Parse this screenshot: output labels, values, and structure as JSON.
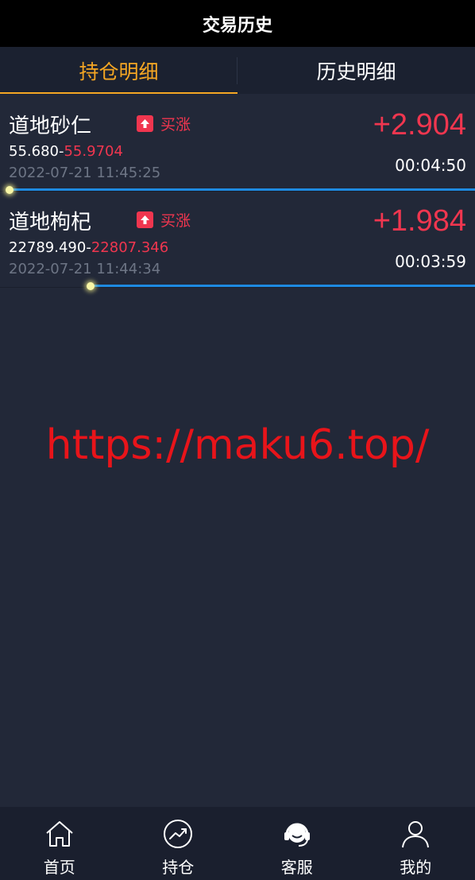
{
  "header": {
    "title": "交易历史"
  },
  "tabs": [
    {
      "label": "持仓明细",
      "active": true
    },
    {
      "label": "历史明细",
      "active": false
    }
  ],
  "positions": [
    {
      "name": "道地砂仁",
      "direction": "买涨",
      "open_price": "55.680",
      "separator": "-",
      "current_price": "55.9704",
      "timestamp": "2022-07-21 11:45:25",
      "profit": "+2.904",
      "countdown": "00:04:50",
      "progress_remaining": 0.98
    },
    {
      "name": "道地枸杞",
      "direction": "买涨",
      "open_price": "22789.490",
      "separator": "-",
      "current_price": "22807.346",
      "timestamp": "2022-07-21 11:44:34",
      "profit": "+1.984",
      "countdown": "00:03:59",
      "progress_remaining": 0.81
    }
  ],
  "watermark": "https://maku6.top/",
  "bottom_nav": [
    {
      "label": "首页",
      "icon": "home-icon"
    },
    {
      "label": "持仓",
      "icon": "chart-circle-icon"
    },
    {
      "label": "客服",
      "icon": "headset-icon"
    },
    {
      "label": "我的",
      "icon": "user-icon"
    }
  ],
  "colors": {
    "background": "#222838",
    "accent": "#f5a623",
    "up_red": "#f0364f",
    "progress_blue": "#1e8ae0"
  }
}
